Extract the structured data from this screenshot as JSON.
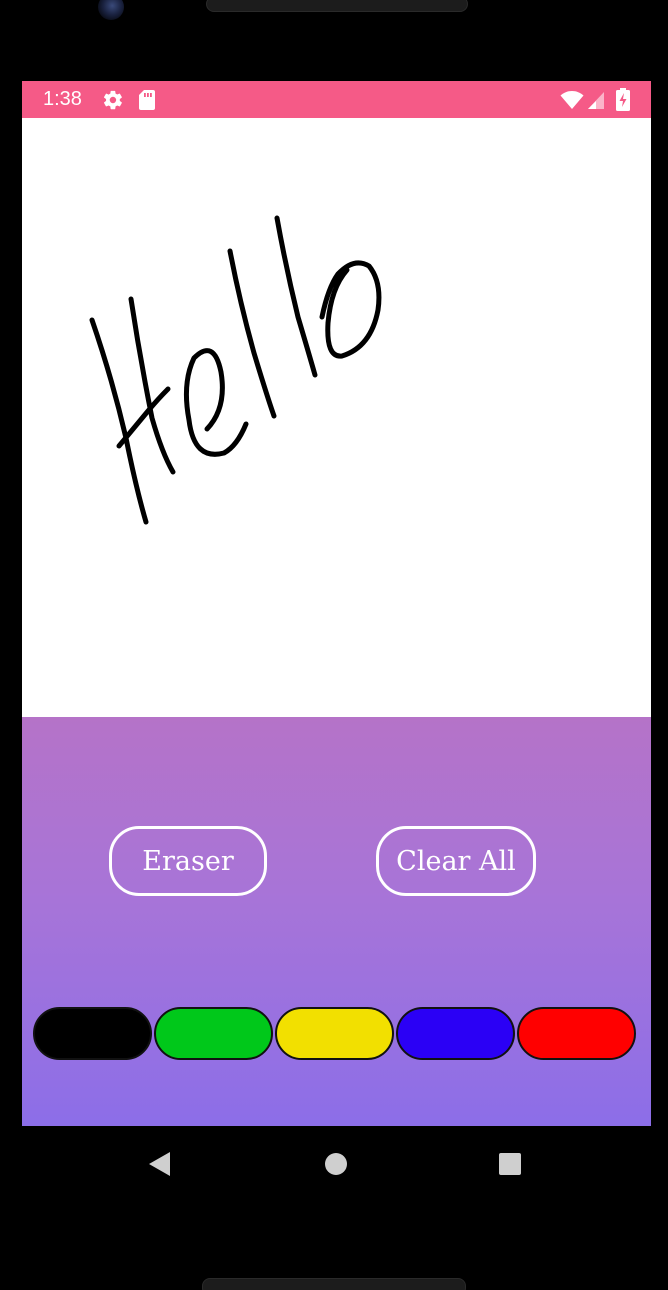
{
  "status_bar": {
    "time": "1:38",
    "background_color": "#f55a87",
    "icons": [
      "gear-icon",
      "sd-card-icon",
      "wifi-icon",
      "signal-icon",
      "battery-charging-icon"
    ]
  },
  "drawing": {
    "text_drawn": "Hello",
    "stroke_color": "#000000"
  },
  "controls": {
    "eraser_label": "Eraser",
    "clear_all_label": "Clear All",
    "colors": [
      {
        "name": "black",
        "hex": "#000000"
      },
      {
        "name": "green",
        "hex": "#00c81a"
      },
      {
        "name": "yellow",
        "hex": "#f2e000"
      },
      {
        "name": "blue",
        "hex": "#2b00f5"
      },
      {
        "name": "red",
        "hex": "#ff0000"
      }
    ]
  },
  "nav_bar": {
    "icons": [
      "back-icon",
      "home-icon",
      "recents-icon"
    ]
  }
}
